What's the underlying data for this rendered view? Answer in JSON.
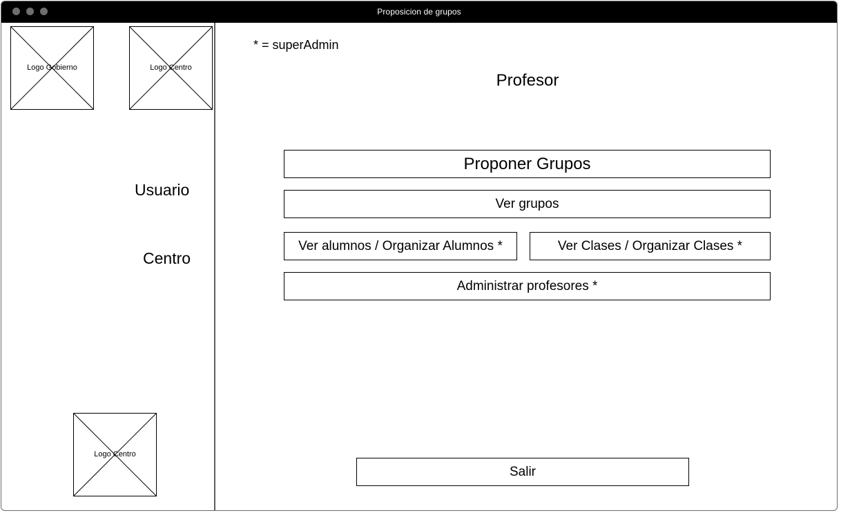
{
  "window": {
    "title": "Proposicion de grupos"
  },
  "sidebar": {
    "logos": [
      {
        "label": "Logo Gobierno"
      },
      {
        "label": "Logo Centro"
      },
      {
        "label": "Logo Centro"
      }
    ],
    "user_label": "Usuario",
    "center_label": "Centro"
  },
  "main": {
    "legend": "* = superAdmin",
    "title": "Profesor",
    "buttons": {
      "propose_groups": "Proponer Grupos",
      "view_groups": "Ver grupos",
      "students": "Ver alumnos / Organizar Alumnos *",
      "classes": "Ver Clases / Organizar Clases *",
      "teachers": "Administrar profesores *",
      "exit": "Salir"
    }
  },
  "icons": {
    "image_placeholder": "image-placeholder-icon",
    "window_controls": [
      "close-window-icon",
      "minimize-window-icon",
      "maximize-window-icon"
    ]
  }
}
